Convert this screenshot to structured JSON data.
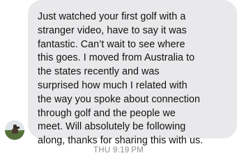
{
  "message": {
    "lines": [
      "Just watched your first golf with a",
      "stranger video, have to say it was",
      "fantastic. Can’t wait to see where",
      "this goes. I moved from Australia to",
      "the states recently and was",
      "surprised how much I related with",
      "the way you spoke about connection",
      "through golf and the people we",
      "meet. Will absolutely be following",
      "along, thanks for sharing this with us."
    ],
    "bubble_color": "#e9e9eb",
    "text_color": "#111111"
  },
  "sender": {
    "avatar_icon": "profile-photo-avatar"
  },
  "timestamp": "THU 9:19 PM"
}
